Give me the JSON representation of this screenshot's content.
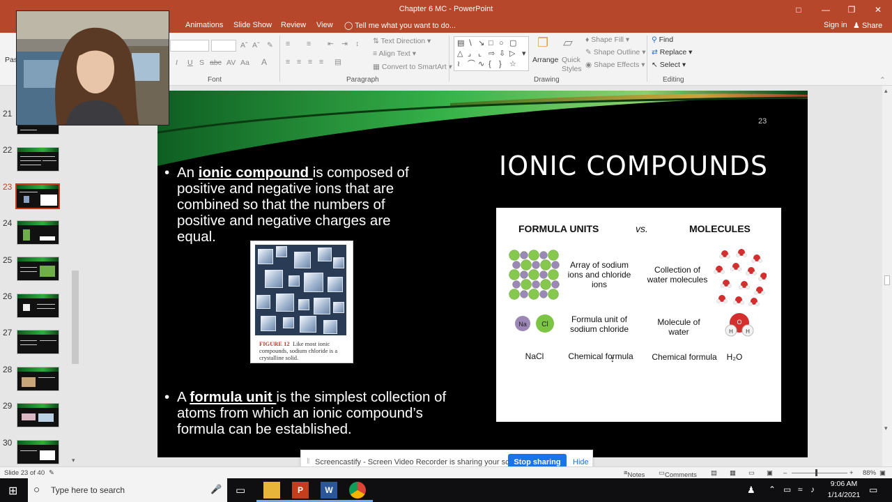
{
  "window": {
    "title": "Chapter 6 MC - PowerPoint"
  },
  "tabs": [
    "Animations",
    "Slide Show",
    "Review",
    "View"
  ],
  "tell_me": "Tell me what you want to do...",
  "sign_in": "Sign in",
  "share": "Share",
  "ribbon": {
    "font_group": "Font",
    "paragraph_group": "Paragraph",
    "drawing_group": "Drawing",
    "editing_group": "Editing",
    "text_direction": "Text Direction",
    "align_text": "Align Text",
    "convert_smartart": "Convert to SmartArt",
    "arrange": "Arrange",
    "quick_styles": "Quick Styles",
    "shape_fill": "Shape Fill",
    "shape_outline": "Shape Outline",
    "shape_effects": "Shape Effects",
    "find": "Find",
    "replace": "Replace",
    "select": "Select",
    "paste_partial": "Pas"
  },
  "thumbnails": {
    "numbers": [
      "21",
      "22",
      "23",
      "24",
      "25",
      "26",
      "27",
      "28",
      "29",
      "30"
    ],
    "active": "23"
  },
  "slide": {
    "number": "23",
    "title": "IONIC COMPOUNDS",
    "bullet1": {
      "pre": "An ",
      "term": "ionic compound ",
      "post_line1": "is composed of",
      "lines": [
        "positive and negative ions that are",
        "combined so that the numbers of",
        "positive and negative charges are",
        "equal."
      ]
    },
    "bullet2": {
      "pre": "A ",
      "term": "formula unit ",
      "post_line1": "is the simplest collection of",
      "lines": [
        "atoms from which an ionic compound’s",
        "formula can be established."
      ]
    },
    "figure": {
      "label": "FIGURE 12",
      "text": "Like most ionic compounds, sodium chloride is a crystalline solid."
    },
    "comparison": {
      "left_head": "FORMULA UNITS",
      "vs": "vs.",
      "right_head": "MOLECULES",
      "row1_left": "Array of sodium ions and chloride ions",
      "row1_right": "Collection of water molecules",
      "row2_left": "Formula unit of sodium chloride",
      "row2_right": "Molecule of water",
      "row3_formula": "NaCl",
      "row3_left": "Chemical formula",
      "row3_right": "Chemical formula",
      "row3_water": "H₂O",
      "na": "Na",
      "cl": "Cl",
      "h": "H",
      "o": "O"
    }
  },
  "castbar": {
    "message": "Screencastify - Screen Video Recorder is sharing your screen.",
    "stop": "Stop sharing",
    "hide": "Hide"
  },
  "status": {
    "slide": "Slide 23 of 40",
    "notes": "Notes",
    "comments": "Comments",
    "zoom": "88%"
  },
  "taskbar": {
    "search_placeholder": "Type here to search",
    "time": "9:06 AM",
    "date": "1/14/2021"
  }
}
